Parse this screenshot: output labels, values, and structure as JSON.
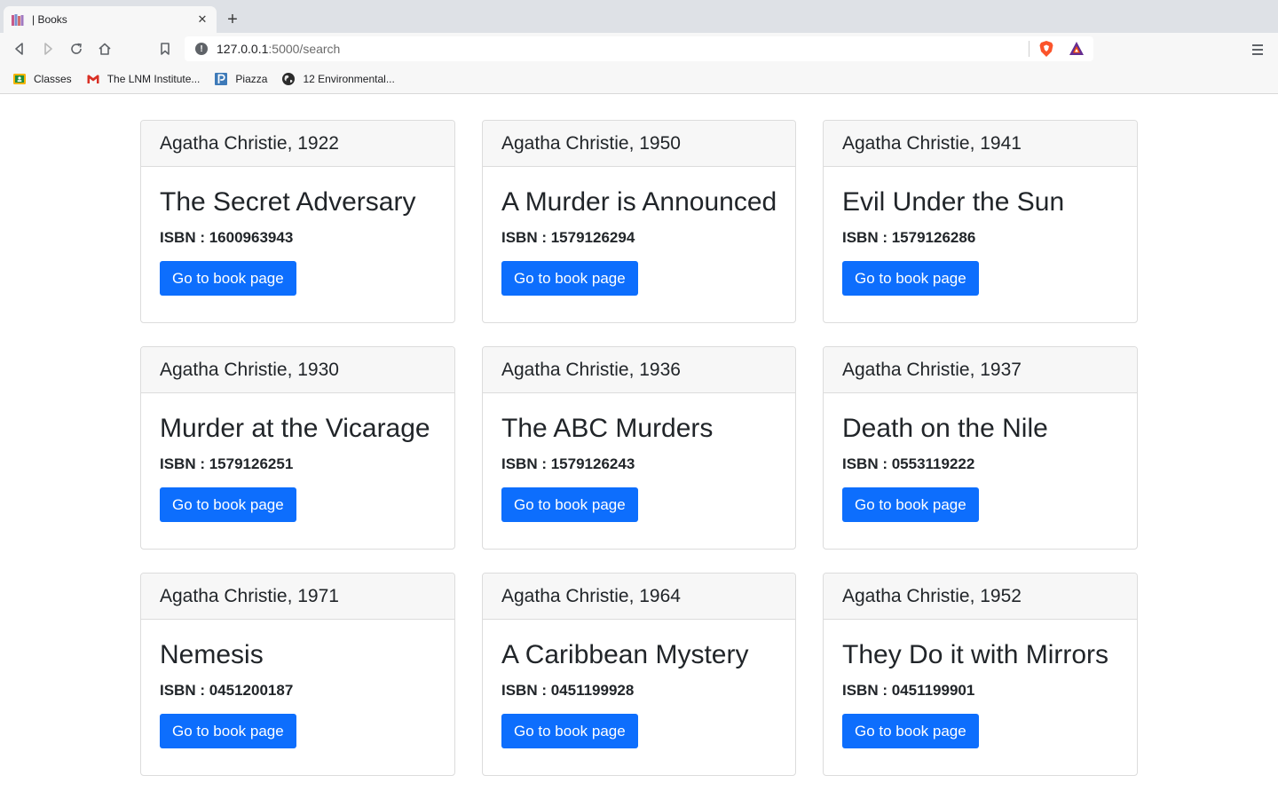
{
  "browser": {
    "tab": {
      "title": "| Books"
    },
    "address_bar": {
      "host": "127.0.0.1",
      "path": ":5000/search"
    },
    "bookmarks": [
      {
        "label": "Classes",
        "icon": "google-classroom-icon"
      },
      {
        "label": "The LNM Institute...",
        "icon": "gmail-icon"
      },
      {
        "label": "Piazza",
        "icon": "piazza-icon"
      },
      {
        "label": "12 Environmental...",
        "icon": "globe-icon"
      }
    ]
  },
  "results": [
    {
      "header": "Agatha Christie, 1922",
      "title": "The Secret Adversary",
      "isbn": "ISBN : 1600963943",
      "button": "Go to book page"
    },
    {
      "header": "Agatha Christie, 1950",
      "title": "A Murder is Announced",
      "isbn": "ISBN : 1579126294",
      "button": "Go to book page"
    },
    {
      "header": "Agatha Christie, 1941",
      "title": "Evil Under the Sun",
      "isbn": "ISBN : 1579126286",
      "button": "Go to book page"
    },
    {
      "header": "Agatha Christie, 1930",
      "title": "Murder at the Vicarage",
      "isbn": "ISBN : 1579126251",
      "button": "Go to book page"
    },
    {
      "header": "Agatha Christie, 1936",
      "title": "The ABC Murders",
      "isbn": "ISBN : 1579126243",
      "button": "Go to book page"
    },
    {
      "header": "Agatha Christie, 1937",
      "title": "Death on the Nile",
      "isbn": "ISBN : 0553119222",
      "button": "Go to book page"
    },
    {
      "header": "Agatha Christie, 1971",
      "title": "Nemesis",
      "isbn": "ISBN : 0451200187",
      "button": "Go to book page"
    },
    {
      "header": "Agatha Christie, 1964",
      "title": "A Caribbean Mystery",
      "isbn": "ISBN : 0451199928",
      "button": "Go to book page"
    },
    {
      "header": "Agatha Christie, 1952",
      "title": "They Do it with Mirrors",
      "isbn": "ISBN : 0451199901",
      "button": "Go to book page"
    }
  ],
  "colors": {
    "primary_button": "#0d6efd",
    "card_header_bg": "#f7f7f7",
    "card_border": "#dcdcdc"
  }
}
